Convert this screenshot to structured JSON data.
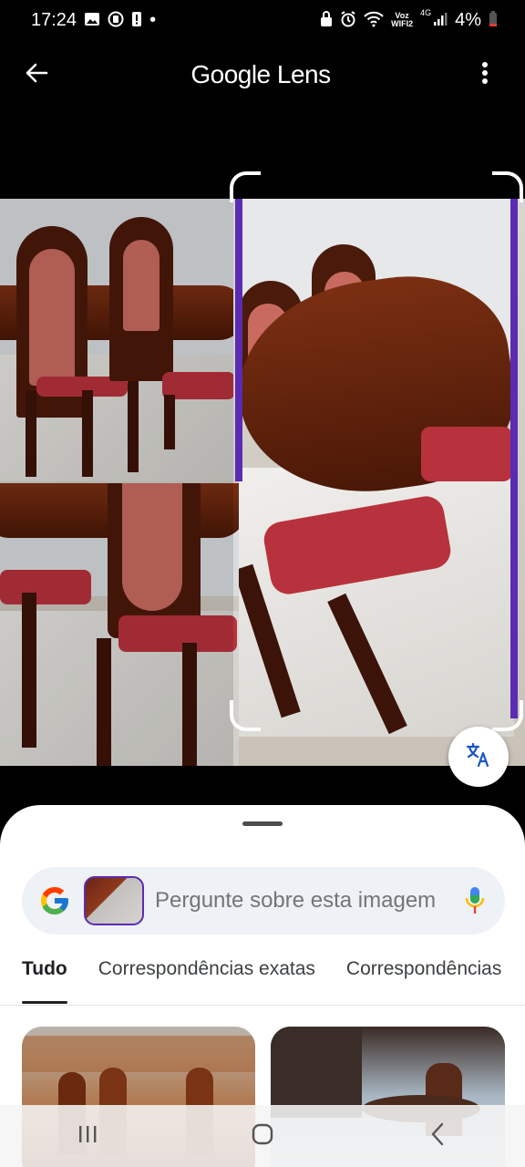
{
  "status_bar": {
    "time": "17:24",
    "dot": "•",
    "voz": "Voz",
    "wifi_label": "WIFI2",
    "network": "4G",
    "battery": "4%"
  },
  "app_bar": {
    "title": "Google Lens",
    "back_icon": "arrow-back-icon",
    "more_icon": "more-vert-icon"
  },
  "image": {
    "translate_icon": "translate-icon",
    "selection_color": "#5b2bb3"
  },
  "search": {
    "placeholder": "Pergunte sobre esta imagem",
    "mic_icon": "mic-icon"
  },
  "tabs": [
    {
      "label": "Tudo",
      "active": true
    },
    {
      "label": "Correspondências exatas",
      "active": false
    },
    {
      "label": "Correspondências",
      "active": false
    }
  ],
  "nav_bar": {
    "recents_icon": "recents-icon",
    "home_icon": "home-icon",
    "back_icon": "back-icon"
  }
}
